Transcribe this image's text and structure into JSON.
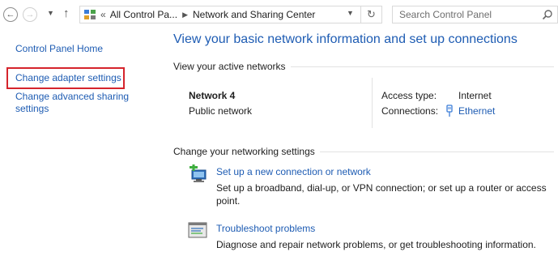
{
  "address_bar": {
    "breadcrumb_prefix": "«",
    "crumb1": "All Control Pa...",
    "crumb2": "Network and Sharing Center",
    "search_placeholder": "Search Control Panel"
  },
  "sidebar": {
    "home": "Control Panel Home",
    "change_adapter": "Change adapter settings",
    "advanced_sharing_line1": "Change advanced sharing",
    "advanced_sharing_line2": "settings"
  },
  "main": {
    "title": "View your basic network information and set up connections",
    "active_networks_label": "View your active networks",
    "network_name": "Network  4",
    "network_type": "Public network",
    "access_type_label": "Access type:",
    "access_type_value": "Internet",
    "connections_label": "Connections:",
    "connections_value": "Ethernet",
    "change_settings_label": "Change your networking settings",
    "setup_link": "Set up a new connection or network",
    "setup_desc_line1": "Set up a broadband, dial-up, or VPN connection; or set up a router or access",
    "setup_desc_line2": "point.",
    "troubleshoot_link": "Troubleshoot problems",
    "troubleshoot_desc": "Diagnose and repair network problems, or get troubleshooting information."
  },
  "colors": {
    "link": "#1e5cb3",
    "highlight": "#d5242c"
  }
}
